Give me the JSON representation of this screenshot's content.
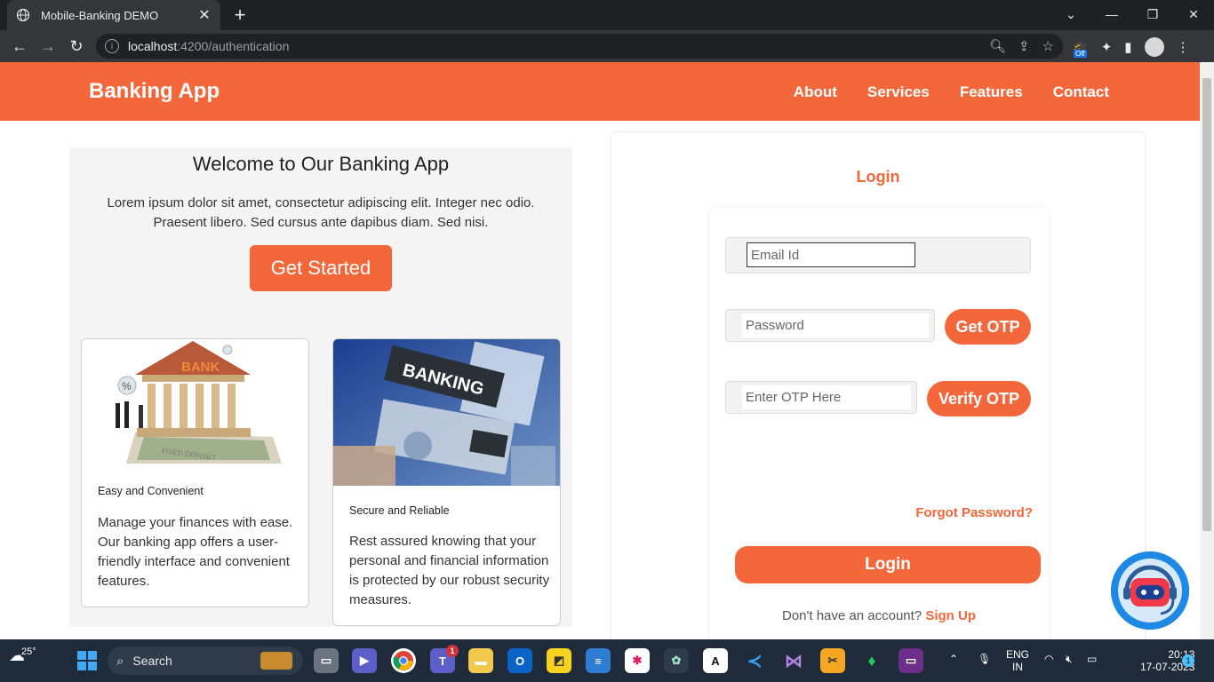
{
  "browser": {
    "tab_title": "Mobile-Banking DEMO",
    "tab_close": "✕",
    "new_tab": "+",
    "url_host": "localhost",
    "url_path": ":4200/authentication",
    "ext_badge": "Off"
  },
  "navbar": {
    "brand": "Banking App",
    "links": [
      "About",
      "Services",
      "Features",
      "Contact"
    ]
  },
  "hero": {
    "title": "Welcome to Our Banking App",
    "text": "Lorem ipsum dolor sit amet, consectetur adipiscing elit. Integer nec odio. Praesent libero. Sed cursus ante dapibus diam. Sed nisi.",
    "cta": "Get Started"
  },
  "cards": [
    {
      "image_label": "BANK",
      "image_sublabel": "FIXED DEPOSIT",
      "caption": "Easy and Convenient",
      "text": "Manage your finances with ease. Our banking app offers a user-friendly interface and convenient features."
    },
    {
      "image_label": "BANKING",
      "caption": "Secure and Reliable",
      "text": "Rest assured knowing that your personal and financial information is protected by our robust security measures."
    }
  ],
  "login": {
    "heading": "Login",
    "email_placeholder": "Email Id",
    "password_placeholder": "Password",
    "get_otp": "Get OTP",
    "otp_placeholder": "Enter OTP Here",
    "verify_otp": "Verify OTP",
    "forgot": "Forgot Password?",
    "submit": "Login",
    "signup_prompt": "Don't have an account?",
    "signup_link": "Sign Up"
  },
  "taskbar": {
    "temperature": "25°",
    "search": "Search",
    "teams_badge": "1",
    "lang_line1": "ENG",
    "lang_line2": "IN",
    "time": "20:13",
    "date": "17-07-2023",
    "notification_count": "1"
  },
  "colors": {
    "accent": "#f4673a",
    "chrome_dark": "#202124",
    "taskbar": "#1f2a3a"
  }
}
